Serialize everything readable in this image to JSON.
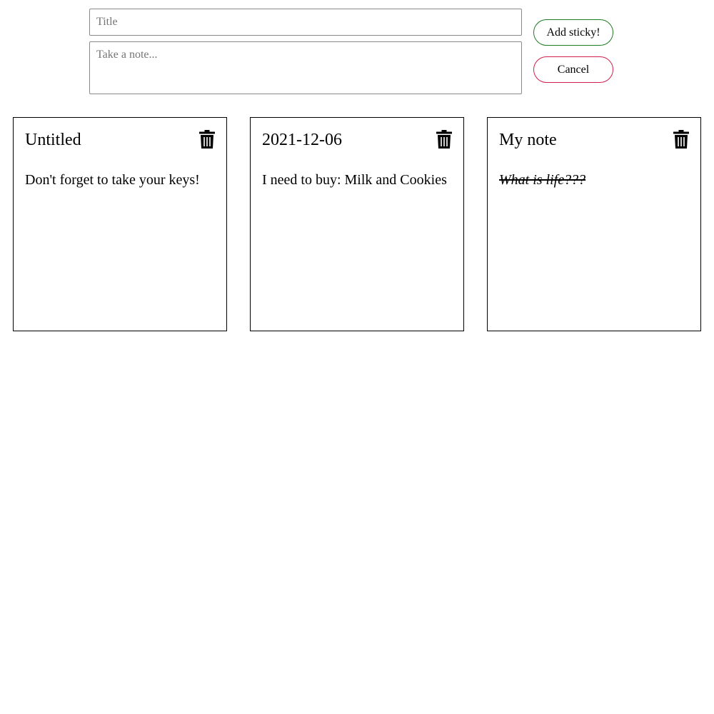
{
  "composer": {
    "title_placeholder": "Title",
    "title_value": "",
    "note_placeholder": "Take a note...",
    "note_value": "",
    "add_label": "Add sticky!",
    "cancel_label": "Cancel"
  },
  "colors": {
    "add_border": "#1e7d22",
    "cancel_border": "#d21f4b",
    "card_border": "#000000"
  },
  "notes": [
    {
      "title": "Untitled",
      "body": "Don't forget to take your keys!",
      "style": "normal",
      "delete_icon": "trash-icon"
    },
    {
      "title": "2021-12-06",
      "body": "I need to buy: Milk and Cookies",
      "style": "normal",
      "delete_icon": "trash-icon"
    },
    {
      "title": "My note",
      "body": "What is life???",
      "style": "italic-strikethrough",
      "delete_icon": "trash-icon"
    }
  ]
}
